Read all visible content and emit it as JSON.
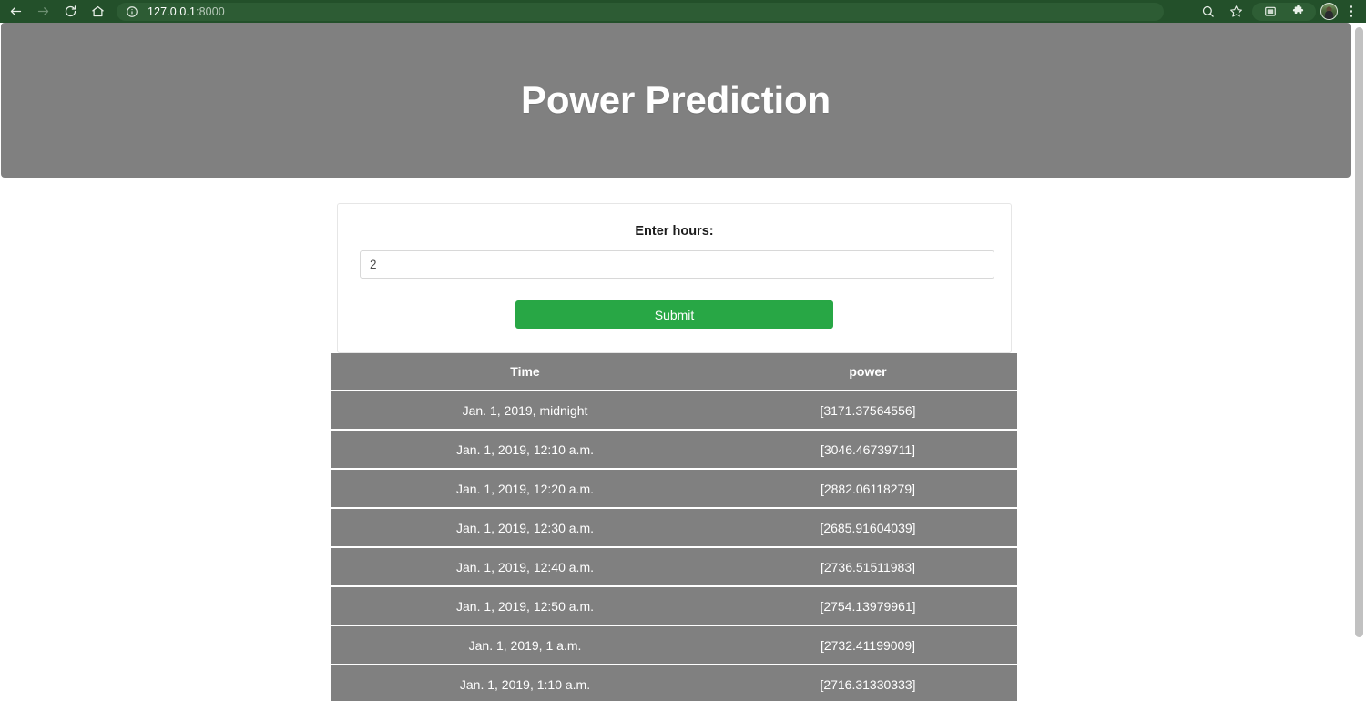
{
  "browser": {
    "back_icon": "back-arrow-icon",
    "forward_icon": "forward-arrow-icon",
    "reload_icon": "reload-icon",
    "home_icon": "home-icon",
    "site_info_icon": "info-circle-icon",
    "url_host": "127.0.0.1",
    "url_port": ":8000",
    "search_icon": "search-icon",
    "bookmark_icon": "star-icon",
    "cast_icon": "cast-screen-icon",
    "extensions_icon": "puzzle-piece-icon",
    "profile_icon": "profile-avatar",
    "menu_icon": "three-dot-menu-icon"
  },
  "header": {
    "title": "Power Prediction"
  },
  "form": {
    "label": "Enter hours:",
    "input_value": "2",
    "input_placeholder": "",
    "submit_label": "Submit"
  },
  "table": {
    "columns": [
      "Time",
      "power"
    ],
    "rows": [
      [
        "Jan. 1, 2019, midnight",
        "[3171.37564556]"
      ],
      [
        "Jan. 1, 2019, 12:10 a.m.",
        "[3046.46739711]"
      ],
      [
        "Jan. 1, 2019, 12:20 a.m.",
        "[2882.06118279]"
      ],
      [
        "Jan. 1, 2019, 12:30 a.m.",
        "[2685.91604039]"
      ],
      [
        "Jan. 1, 2019, 12:40 a.m.",
        "[2736.51511983]"
      ],
      [
        "Jan. 1, 2019, 12:50 a.m.",
        "[2754.13979961]"
      ],
      [
        "Jan. 1, 2019, 1 a.m.",
        "[2732.41199009]"
      ],
      [
        "Jan. 1, 2019, 1:10 a.m.",
        "[2716.31330333]"
      ]
    ]
  },
  "colors": {
    "browser_chrome": "#23502a",
    "banner_gray": "#808080",
    "accent_green": "#28a745",
    "table_gray": "#808080"
  }
}
